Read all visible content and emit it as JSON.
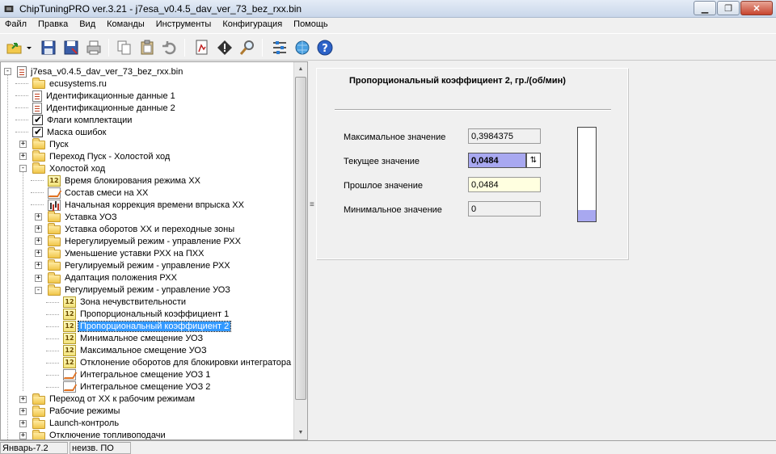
{
  "window": {
    "title": "ChipTuningPRO ver.3.21 - j7esa_v0.4.5_dav_ver_73_bez_rxx.bin",
    "controls": [
      "minimize-icon",
      "maximize-icon",
      "close-icon"
    ]
  },
  "menu": [
    "Файл",
    "Правка",
    "Вид",
    "Команды",
    "Инструменты",
    "Конфигурация",
    "Помощь"
  ],
  "toolbar": {
    "icons": [
      "open-folder-icon",
      "dropdown-arrow-icon",
      "save-icon",
      "save-as-icon",
      "print-icon",
      "copy-icon",
      "paste-icon",
      "undo-icon",
      "compare-icon",
      "checksum-icon",
      "search-icon",
      "settings-icon",
      "connect-icon",
      "help-icon"
    ]
  },
  "tree": [
    {
      "label": "j7esa_v0.4.5_dav_ver_73_bez_rxx.bin",
      "level": 0,
      "icon": "file",
      "exp": "-"
    },
    {
      "label": "ecusystems.ru",
      "level": 1,
      "icon": "folder",
      "exp": ""
    },
    {
      "label": "Идентификационные данные 1",
      "level": 1,
      "icon": "doc",
      "exp": ""
    },
    {
      "label": "Идентификационные данные 2",
      "level": 1,
      "icon": "doc",
      "exp": ""
    },
    {
      "label": "Флаги комплектации",
      "level": 1,
      "icon": "check",
      "exp": ""
    },
    {
      "label": "Маска ошибок",
      "level": 1,
      "icon": "check",
      "exp": ""
    },
    {
      "label": "Пуск",
      "level": 1,
      "icon": "folder",
      "exp": "+"
    },
    {
      "label": "Переход Пуск - Холостой ход",
      "level": 1,
      "icon": "folder",
      "exp": "+"
    },
    {
      "label": "Холостой ход",
      "level": 1,
      "icon": "folder",
      "exp": "-"
    },
    {
      "label": "Время блокирования режима ХХ",
      "level": 2,
      "icon": "num",
      "exp": ""
    },
    {
      "label": "Состав смеси на ХХ",
      "level": 2,
      "icon": "graph",
      "exp": ""
    },
    {
      "label": "Начальная коррекция времени впрыска ХХ",
      "level": 2,
      "icon": "bars",
      "exp": ""
    },
    {
      "label": "Уставка УОЗ",
      "level": 2,
      "icon": "folder",
      "exp": "+"
    },
    {
      "label": "Уставка оборотов ХХ и переходные зоны",
      "level": 2,
      "icon": "folder",
      "exp": "+"
    },
    {
      "label": "Нерегулируемый режим - управление РХХ",
      "level": 2,
      "icon": "folder",
      "exp": "+"
    },
    {
      "label": "Уменьшение уставки РХХ на ПХХ",
      "level": 2,
      "icon": "folder",
      "exp": "+"
    },
    {
      "label": "Регулируемый режим - управление РХХ",
      "level": 2,
      "icon": "folder",
      "exp": "+"
    },
    {
      "label": "Адаптация положения  РХХ",
      "level": 2,
      "icon": "folder",
      "exp": "+"
    },
    {
      "label": "Регулируемый режим - управление УОЗ",
      "level": 2,
      "icon": "folder",
      "exp": "-"
    },
    {
      "label": "Зона нечувствительности",
      "level": 3,
      "icon": "num",
      "exp": ""
    },
    {
      "label": "Пропорциональный коэффициент 1",
      "level": 3,
      "icon": "num",
      "exp": ""
    },
    {
      "label": "Пропорциональный коэффициент 2",
      "level": 3,
      "icon": "num",
      "exp": "",
      "selected": true
    },
    {
      "label": "Минимальное смещение УОЗ",
      "level": 3,
      "icon": "num",
      "exp": ""
    },
    {
      "label": "Максимальное смещение УОЗ",
      "level": 3,
      "icon": "num",
      "exp": ""
    },
    {
      "label": "Отклонение оборотов для блокировки интегратора",
      "level": 3,
      "icon": "num",
      "exp": ""
    },
    {
      "label": "Интегральное смещение УОЗ 1",
      "level": 3,
      "icon": "graph",
      "exp": ""
    },
    {
      "label": "Интегральное смещение УОЗ 2",
      "level": 3,
      "icon": "graph",
      "exp": ""
    },
    {
      "label": "Переход от ХХ к рабочим режимам",
      "level": 1,
      "icon": "folder",
      "exp": "+"
    },
    {
      "label": "Рабочие режимы",
      "level": 1,
      "icon": "folder",
      "exp": "+"
    },
    {
      "label": "Launch-контроль",
      "level": 1,
      "icon": "folder",
      "exp": "+"
    },
    {
      "label": "Отключение топливоподачи",
      "level": 1,
      "icon": "folder",
      "exp": "+"
    }
  ],
  "param": {
    "title": "Пропорциональный коэффициент 2, гр./(об/мин)",
    "max_label": "Максимальное значение",
    "max_value": "0,3984375",
    "current_label": "Текущее значение",
    "current_value": "0,0484",
    "prev_label": "Прошлое значение",
    "prev_value": "0,0484",
    "min_label": "Минимальное значение",
    "min_value": "0",
    "gauge_level": 0.1215
  },
  "status": {
    "left": "Январь-7.2",
    "right": "неизв. ПО"
  },
  "colors": {
    "selection": "#3399ff",
    "current_field": "#a8a8f0",
    "prev_field": "#ffffe0",
    "gauge_fill": "#a8a8f0"
  }
}
